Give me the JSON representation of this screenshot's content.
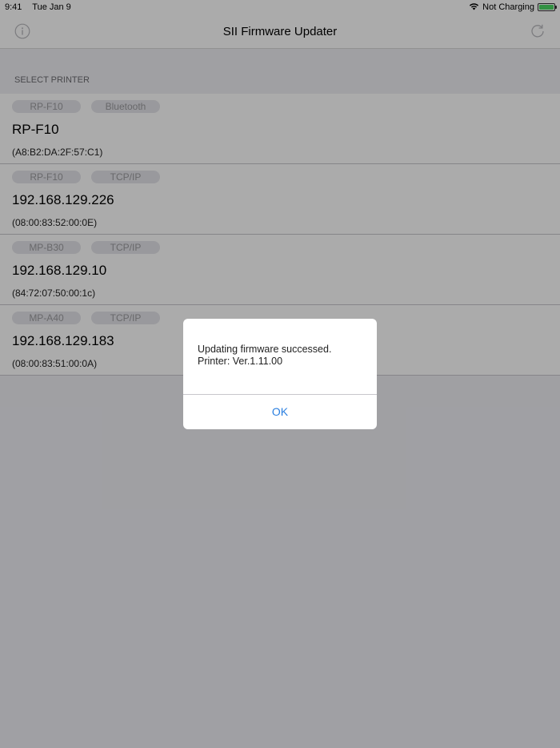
{
  "status_bar": {
    "time": "9:41",
    "date": "Tue Jan 9",
    "charging": "Not Charging"
  },
  "nav": {
    "title": "SII Firmware Updater",
    "left_icon": "info-icon",
    "right_icon": "refresh-icon"
  },
  "section": {
    "header": "SELECT PRINTER"
  },
  "printers": [
    {
      "model": "RP-F10",
      "interface": "Bluetooth",
      "name": "RP-F10",
      "mac": "(A8:B2:DA:2F:57:C1)"
    },
    {
      "model": "RP-F10",
      "interface": "TCP/IP",
      "name": "192.168.129.226",
      "mac": "(08:00:83:52:00:0E)"
    },
    {
      "model": "MP-B30",
      "interface": "TCP/IP",
      "name": "192.168.129.10",
      "mac": "(84:72:07:50:00:1c)"
    },
    {
      "model": "MP-A40",
      "interface": "TCP/IP",
      "name": "192.168.129.183",
      "mac": "(08:00:83:51:00:0A)"
    }
  ],
  "alert": {
    "line1": "Updating firmware successed.",
    "line2": "Printer: Ver.1.11.00",
    "ok_label": "OK"
  },
  "colors": {
    "accent": "#2a7fe0",
    "battery": "#4cd964"
  }
}
